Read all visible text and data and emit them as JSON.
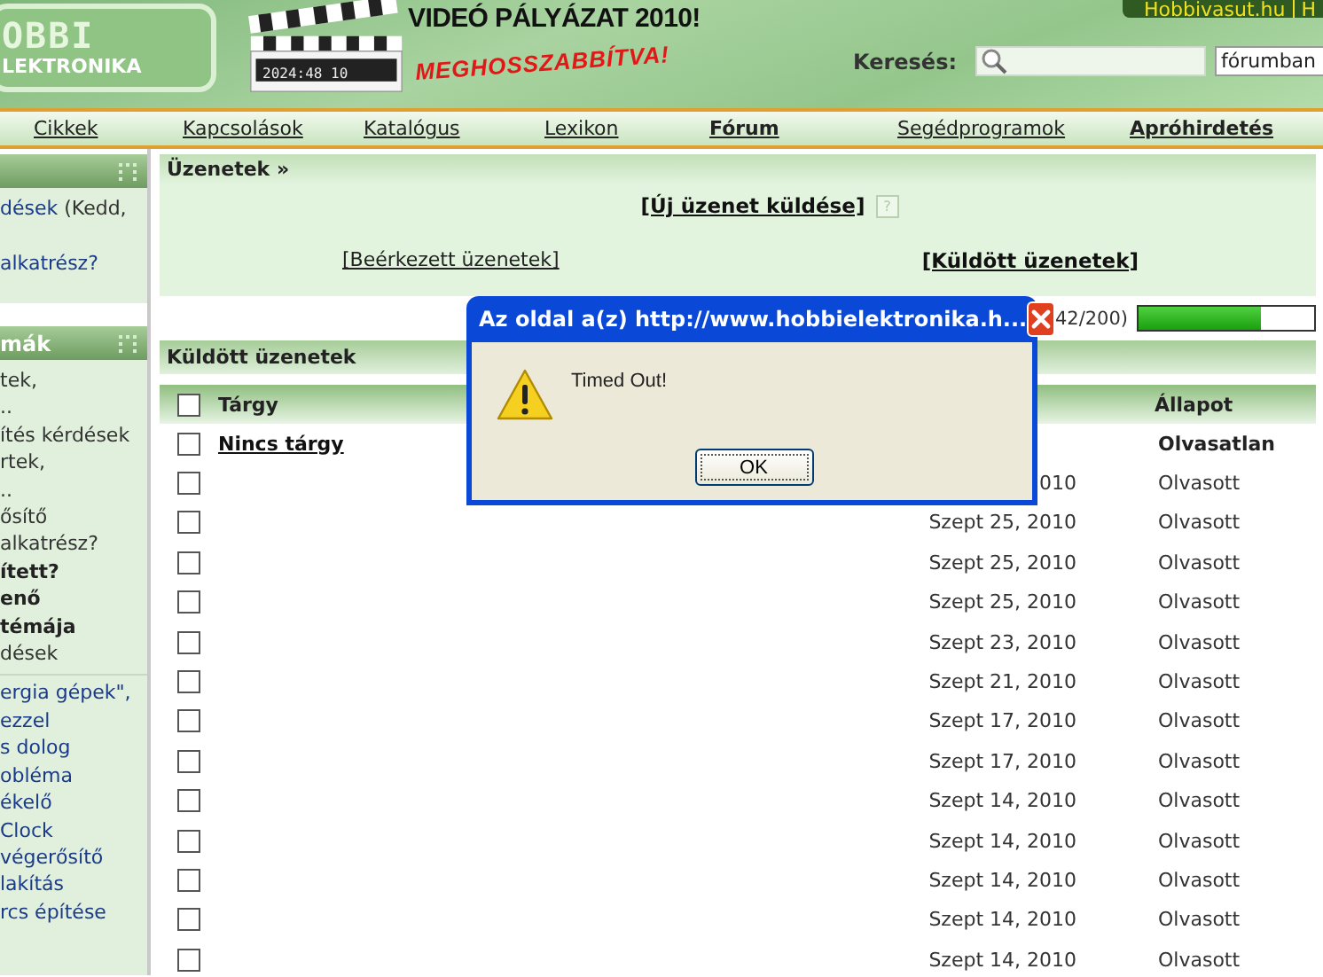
{
  "header": {
    "logo": {
      "line1": "OBBI",
      "line2": "LEKTRONIKA"
    },
    "clock": "2024:48 10",
    "headline": "VIDEÓ PÁLYÁZAT 2010!",
    "subline": "MEGHOSSZABBÍTVA!",
    "top_links": [
      "Hobbivasut.hu",
      "H"
    ],
    "search": {
      "label": "Keresés:",
      "scope": "fórumban"
    }
  },
  "nav": [
    {
      "label": "Cikkek",
      "highlighted": false
    },
    {
      "label": "Kapcsolások",
      "highlighted": false
    },
    {
      "label": "Katalógus",
      "highlighted": false
    },
    {
      "label": "Lexikon",
      "highlighted": false
    },
    {
      "label": "Fórum",
      "highlighted": true
    },
    {
      "label": "Segédprogramok",
      "highlighted": false
    },
    {
      "label": "Apróhirdetés",
      "highlighted": true
    }
  ],
  "sidebar": [
    {
      "lines": [
        {
          "segments": [
            {
              "text": "dések",
              "kind": "link"
            },
            {
              "text": " (Kedd,",
              "kind": "text"
            }
          ]
        },
        {
          "segments": [
            {
              "text": "alkatrész?",
              "kind": "link"
            }
          ]
        }
      ]
    },
    {
      "title": "mák",
      "lines": [
        {
          "segments": [
            {
              "text": "tek,",
              "kind": "text"
            }
          ]
        },
        {
          "segments": [
            {
              "text": "..",
              "kind": "text"
            }
          ]
        },
        {
          "segments": [
            {
              "text": "ítés kérdések",
              "kind": "text"
            }
          ]
        },
        {
          "segments": [
            {
              "text": "rtek,",
              "kind": "text"
            }
          ]
        },
        {
          "segments": [
            {
              "text": "..",
              "kind": "text"
            }
          ]
        },
        {
          "segments": [
            {
              "text": "ősítő",
              "kind": "text"
            }
          ]
        },
        {
          "segments": [
            {
              "text": "alkatrész?",
              "kind": "text"
            }
          ]
        },
        {
          "segments": [
            {
              "text": "ített?",
              "kind": "bold"
            }
          ]
        },
        {
          "segments": [
            {
              "text": "enő",
              "kind": "bold"
            }
          ]
        },
        {
          "segments": [
            {
              "text": "témája",
              "kind": "bold"
            }
          ]
        },
        {
          "segments": [
            {
              "text": "dések",
              "kind": "text"
            }
          ]
        },
        {
          "segments": [
            {
              "text": "ergia gépek\",",
              "kind": "link"
            }
          ]
        },
        {
          "segments": [
            {
              "text": " ezzel",
              "kind": "link"
            }
          ]
        },
        {
          "segments": [
            {
              "text": "s dolog",
              "kind": "link"
            }
          ]
        },
        {
          "segments": [
            {
              "text": "obléma",
              "kind": "link"
            }
          ]
        },
        {
          "segments": [
            {
              "text": "ékelő",
              "kind": "link"
            }
          ]
        },
        {
          "segments": [
            {
              "text": "Clock",
              "kind": "link"
            }
          ]
        },
        {
          "segments": [
            {
              "text": "végerősítő",
              "kind": "link"
            }
          ]
        },
        {
          "segments": [
            {
              "text": "lakítás",
              "kind": "link"
            }
          ]
        },
        {
          "segments": [
            {
              "text": "rcs építése",
              "kind": "link"
            }
          ]
        }
      ]
    }
  ],
  "messages": {
    "title": "Üzenetek »",
    "new_link": "[Új üzenet küldése]",
    "help": "?",
    "inbox_link": "[Beérkezett üzenetek]",
    "sent_link": "[Küldött üzenetek]",
    "quota": {
      "text": "42/200)",
      "level": 0.7
    }
  },
  "sent": {
    "title": "Küldött üzenetek",
    "select_all_checked": false,
    "columns": [
      "Tárgy",
      "Állapot"
    ],
    "rows": [
      {
        "checked": false,
        "subject": "Nincs tárgy",
        "status": "Olvasatlan",
        "unread": true
      },
      {
        "checked": false,
        "date": "010",
        "status": "Olvasott",
        "unread": false
      },
      {
        "checked": false,
        "date": "Szept 25, 2010",
        "status": "Olvasott",
        "unread": false
      },
      {
        "checked": false,
        "date": "Szept 25, 2010",
        "status": "Olvasott",
        "unread": false
      },
      {
        "checked": false,
        "date": "Szept 25, 2010",
        "status": "Olvasott",
        "unread": false
      },
      {
        "checked": false,
        "date": "Szept 23, 2010",
        "status": "Olvasott",
        "unread": false
      },
      {
        "checked": false,
        "date": "Szept 21, 2010",
        "status": "Olvasott",
        "unread": false
      },
      {
        "checked": false,
        "date": "Szept 17, 2010",
        "status": "Olvasott",
        "unread": false
      },
      {
        "checked": false,
        "date": "Szept 17, 2010",
        "status": "Olvasott",
        "unread": false
      },
      {
        "checked": false,
        "date": "Szept 14, 2010",
        "status": "Olvasott",
        "unread": false
      },
      {
        "checked": false,
        "date": "Szept 14, 2010",
        "status": "Olvasott",
        "unread": false
      },
      {
        "checked": false,
        "date": "Szept 14, 2010",
        "status": "Olvasott",
        "unread": false
      },
      {
        "checked": false,
        "date": "Szept 14, 2010",
        "status": "Olvasott",
        "unread": false
      },
      {
        "checked": false,
        "date": "Szept 14, 2010",
        "status": "Olvasott",
        "unread": false
      }
    ]
  },
  "dialog": {
    "title": "Az oldal a(z) http://www.hobbielektronika.h...",
    "message": "Timed Out!",
    "button": "OK"
  }
}
